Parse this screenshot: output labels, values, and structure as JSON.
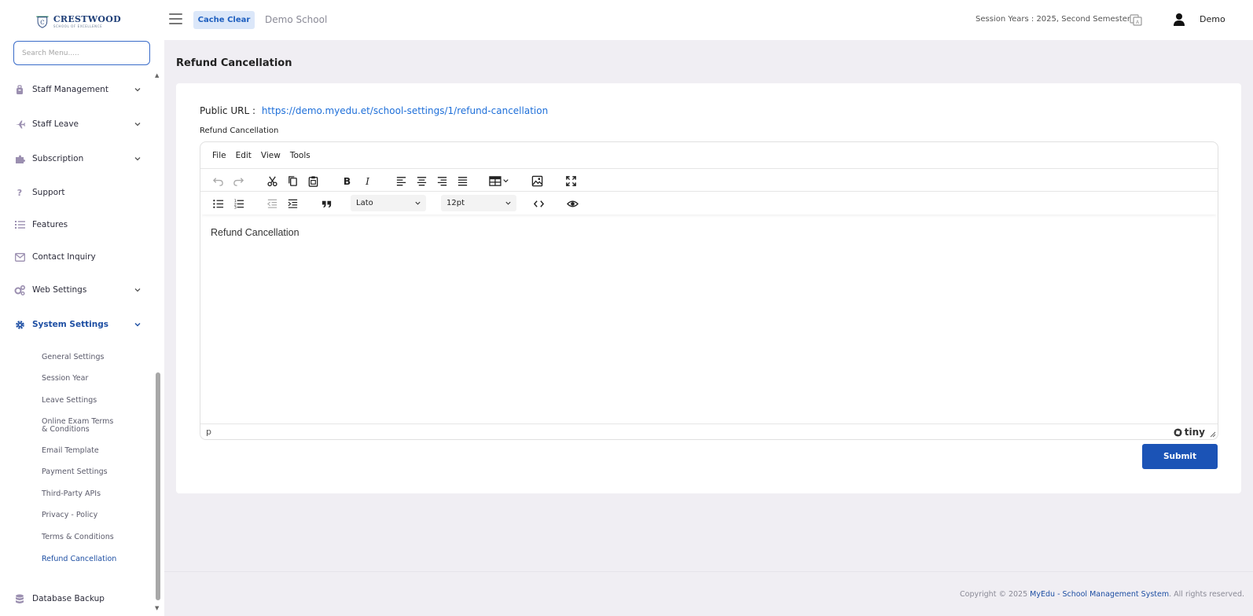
{
  "brand": {
    "title": "CRESTWOOD",
    "subtitle": "SCHOOL OF EXCELLENCE",
    "crest_letter": "C"
  },
  "sidebar": {
    "search_placeholder": "Search Menu.....",
    "items": [
      {
        "label": "Staff Management",
        "icon": "staff-management-icon",
        "expandable": true
      },
      {
        "label": "Staff Leave",
        "icon": "plane-icon",
        "expandable": true
      },
      {
        "label": "Subscription",
        "icon": "puzzle-icon",
        "expandable": true
      },
      {
        "label": "Support",
        "icon": "question-icon",
        "expandable": false
      },
      {
        "label": "Features",
        "icon": "list-icon",
        "expandable": false
      },
      {
        "label": "Contact Inquiry",
        "icon": "envelope-icon",
        "expandable": false
      },
      {
        "label": "Web Settings",
        "icon": "cogs-icon",
        "expandable": true
      },
      {
        "label": "System Settings",
        "icon": "gear-icon",
        "expandable": true,
        "active": true
      }
    ],
    "sub_items": [
      {
        "label": "General Settings"
      },
      {
        "label": "Session Year"
      },
      {
        "label": "Leave Settings"
      },
      {
        "label": "Online Exam Terms",
        "label2": "& Conditions"
      },
      {
        "label": "Email Template"
      },
      {
        "label": "Payment Settings"
      },
      {
        "label": "Third-Party APIs"
      },
      {
        "label": "Privacy - Policy"
      },
      {
        "label": "Terms & Conditions"
      },
      {
        "label": "Refund Cancellation",
        "active": true
      }
    ],
    "bottom_item": {
      "label": "Database Backup",
      "icon": "database-icon"
    }
  },
  "header": {
    "cache_label": "Cache Clear",
    "school_name": "Demo School",
    "session": "Session Years : 2025, Second Semester",
    "user_name": "Demo"
  },
  "page": {
    "title": "Refund Cancellation",
    "public_url_label": "Public URL :",
    "public_url": "https://demo.myedu.et/school-settings/1/refund-cancellation",
    "field_label": "Refund Cancellation",
    "submit_label": "Submit"
  },
  "editor": {
    "menus": [
      "File",
      "Edit",
      "View",
      "Tools"
    ],
    "font_family": "Lato",
    "font_size": "12pt",
    "content": "Refund Cancellation",
    "status_path": "p",
    "brand": "tiny"
  },
  "footer": {
    "prefix": "Copyright © 2025",
    "link": "MyEdu - School Management System",
    "suffix": ". All rights reserved."
  },
  "colors": {
    "primary": "#1b53b6",
    "accent_link": "#1e6fd9",
    "cache_bg": "#dbe7f9",
    "page_bg": "#f0eef3"
  }
}
